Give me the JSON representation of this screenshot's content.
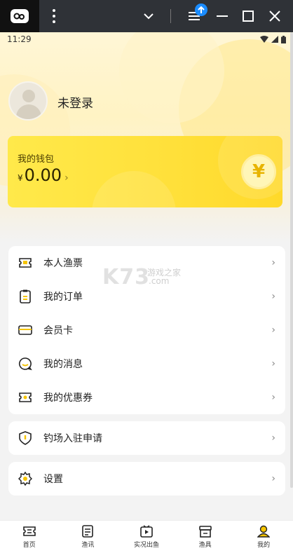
{
  "status": {
    "time": "11:29"
  },
  "profile": {
    "login_status": "未登录"
  },
  "wallet": {
    "title": "我的钱包",
    "currency": "¥",
    "balance": "0.00",
    "coin_symbol": "¥"
  },
  "menu_group_1": [
    {
      "label": "本人渔票",
      "icon": "ticket-icon"
    },
    {
      "label": "我的订单",
      "icon": "clipboard-icon"
    },
    {
      "label": "会员卡",
      "icon": "card-icon"
    },
    {
      "label": "我的消息",
      "icon": "message-icon"
    },
    {
      "label": "我的优惠券",
      "icon": "coupon-icon"
    }
  ],
  "menu_group_2": [
    {
      "label": "钓场入驻申请",
      "icon": "shield-icon"
    }
  ],
  "menu_group_3": [
    {
      "label": "设置",
      "icon": "gear-icon"
    }
  ],
  "watermark": {
    "logo": "K73",
    "text": "游戏之家",
    "domain": ".com"
  },
  "tabbar": [
    {
      "label": "首页",
      "icon": "home-ticket-icon"
    },
    {
      "label": "渔讯",
      "icon": "news-icon"
    },
    {
      "label": "实况出鱼",
      "icon": "video-icon"
    },
    {
      "label": "渔具",
      "icon": "store-icon"
    },
    {
      "label": "我的",
      "icon": "user-icon",
      "active": true
    }
  ],
  "colors": {
    "accent": "#ffe03a",
    "icon_yellow": "#f5c400"
  }
}
